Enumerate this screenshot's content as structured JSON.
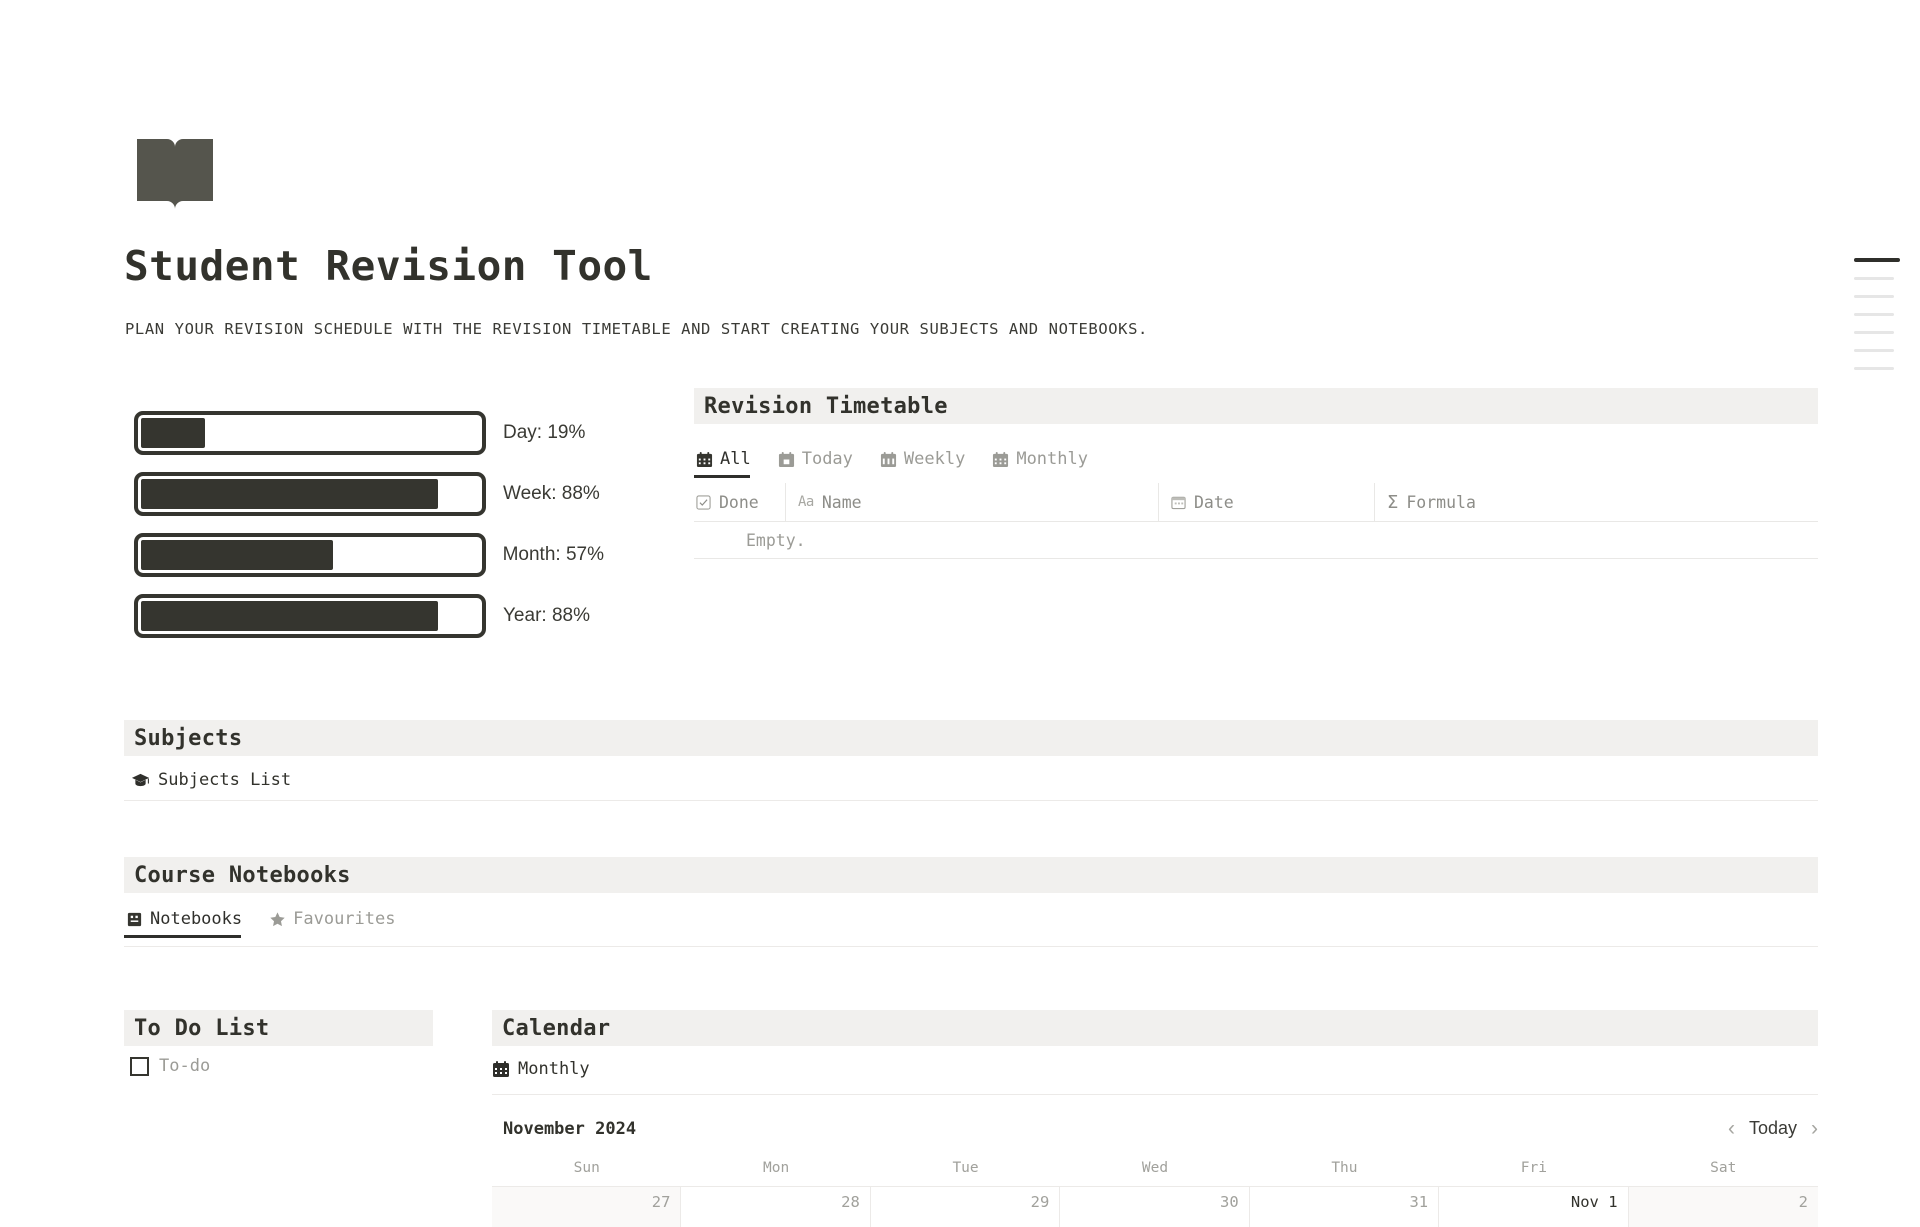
{
  "header": {
    "logo_icon": "open-book-icon",
    "title": "Student Revision Tool",
    "subtitle": "PLAN YOUR REVISION SCHEDULE WITH THE REVISION TIMETABLE AND START CREATING YOUR SUBJECTS AND NOTEBOOKS."
  },
  "colors": {
    "ink": "#32322c",
    "band": "#f1f0ee",
    "muted": "#9b9b96",
    "rule": "#eceae8",
    "weekend": "#faf9f8"
  },
  "toc": {
    "dashes": 7,
    "active_index": 0
  },
  "progress": {
    "items": [
      {
        "label": "Day: 19%",
        "name": "Day",
        "percent": 19
      },
      {
        "label": "Week: 88%",
        "name": "Week",
        "percent": 88
      },
      {
        "label": "Month: 57%",
        "name": "Month",
        "percent": 57
      },
      {
        "label": "Year: 88%",
        "name": "Year",
        "percent": 88
      }
    ]
  },
  "timetable": {
    "title": "Revision Timetable",
    "tabs": [
      {
        "label": "All",
        "icon": "calendar-icon",
        "active": true
      },
      {
        "label": "Today",
        "icon": "calendar-today-icon",
        "active": false
      },
      {
        "label": "Weekly",
        "icon": "calendar-week-icon",
        "active": false
      },
      {
        "label": "Monthly",
        "icon": "calendar-month-icon",
        "active": false
      }
    ],
    "columns": [
      {
        "label": "Done",
        "icon": "checkbox-icon"
      },
      {
        "label": "Name",
        "icon": "text-aa-icon"
      },
      {
        "label": "Date",
        "icon": "calendar-small-icon"
      },
      {
        "label": "Formula",
        "icon": "sigma-icon"
      }
    ],
    "empty_text": "Empty."
  },
  "subjects": {
    "title": "Subjects",
    "items": [
      {
        "label": "Subjects List",
        "icon": "graduation-cap-icon"
      }
    ]
  },
  "notebooks": {
    "title": "Course Notebooks",
    "tabs": [
      {
        "label": "Notebooks",
        "icon": "notebook-icon",
        "active": true
      },
      {
        "label": "Favourites",
        "icon": "star-icon",
        "active": false
      }
    ]
  },
  "todo": {
    "title": "To Do List",
    "placeholder": "To-do"
  },
  "calendar": {
    "title": "Calendar",
    "view": {
      "label": "Monthly",
      "icon": "calendar-icon"
    },
    "month_label": "November 2024",
    "today_label": "Today",
    "prev_icon": "chevron-left-icon",
    "next_icon": "chevron-right-icon",
    "weekdays": [
      "Sun",
      "Mon",
      "Tue",
      "Wed",
      "Thu",
      "Fri",
      "Sat"
    ],
    "week_row": [
      {
        "label": "27",
        "weekend": true,
        "month_start": false
      },
      {
        "label": "28",
        "weekend": false,
        "month_start": false
      },
      {
        "label": "29",
        "weekend": false,
        "month_start": false
      },
      {
        "label": "30",
        "weekend": false,
        "month_start": false
      },
      {
        "label": "31",
        "weekend": false,
        "month_start": false
      },
      {
        "label": "Nov 1",
        "weekend": false,
        "month_start": true
      },
      {
        "label": "2",
        "weekend": true,
        "month_start": false
      }
    ]
  }
}
